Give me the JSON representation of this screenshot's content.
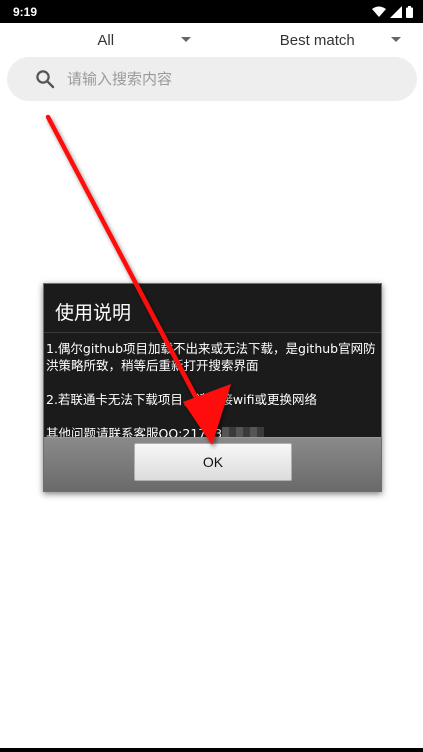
{
  "status_bar": {
    "time": "9:19",
    "icons": [
      "wifi-icon",
      "signal-icon",
      "battery-icon"
    ]
  },
  "filters": {
    "scope": "All",
    "sort": "Best match"
  },
  "search": {
    "placeholder": "请输入搜索内容",
    "value": ""
  },
  "dialog": {
    "title": "使用说明",
    "line1": "1.偶尔github项目加载不出来或无法下载，是github官网防洪策略所致，稍等后重新打开搜索界面",
    "line2": "2.若联通卡无法下载项目，请连接wifi或更换网络",
    "line3": "其他问题请联系客服QQ:21703",
    "ok_label": "OK"
  },
  "colors": {
    "arrow": "#ff0000",
    "dialog_bg": "#1b1b1b",
    "search_bg": "#eeeeee"
  }
}
